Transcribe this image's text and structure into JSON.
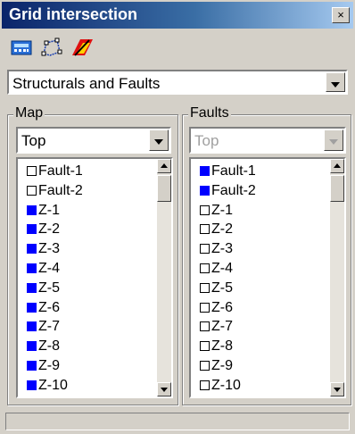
{
  "window": {
    "title": "Grid intersection",
    "close_label": "×"
  },
  "toolbar": {
    "icons": [
      "grid-calc-icon",
      "grid-points-icon",
      "fault-surface-icon"
    ]
  },
  "top_combo": {
    "value": "Structurals and Faults"
  },
  "map_group": {
    "label": "Map",
    "combo_value": "Top",
    "items": [
      {
        "label": "Fault-1",
        "checked": false
      },
      {
        "label": "Fault-2",
        "checked": false
      },
      {
        "label": "Z-1",
        "checked": true
      },
      {
        "label": "Z-2",
        "checked": true
      },
      {
        "label": "Z-3",
        "checked": true
      },
      {
        "label": "Z-4",
        "checked": true
      },
      {
        "label": "Z-5",
        "checked": true
      },
      {
        "label": "Z-6",
        "checked": true
      },
      {
        "label": "Z-7",
        "checked": true
      },
      {
        "label": "Z-8",
        "checked": true
      },
      {
        "label": "Z-9",
        "checked": true
      },
      {
        "label": "Z-10",
        "checked": true
      }
    ]
  },
  "faults_group": {
    "label": "Faults",
    "combo_value": "Top",
    "combo_disabled": true,
    "items": [
      {
        "label": "Fault-1",
        "checked": true
      },
      {
        "label": "Fault-2",
        "checked": true
      },
      {
        "label": "Z-1",
        "checked": false
      },
      {
        "label": "Z-2",
        "checked": false
      },
      {
        "label": "Z-3",
        "checked": false
      },
      {
        "label": "Z-4",
        "checked": false
      },
      {
        "label": "Z-5",
        "checked": false
      },
      {
        "label": "Z-6",
        "checked": false
      },
      {
        "label": "Z-7",
        "checked": false
      },
      {
        "label": "Z-8",
        "checked": false
      },
      {
        "label": "Z-9",
        "checked": false
      },
      {
        "label": "Z-10",
        "checked": false
      }
    ]
  },
  "colors": {
    "checked": "#0000ff",
    "titlebar_start": "#0a246a",
    "titlebar_end": "#a6caf0",
    "face": "#d4d0c8"
  }
}
